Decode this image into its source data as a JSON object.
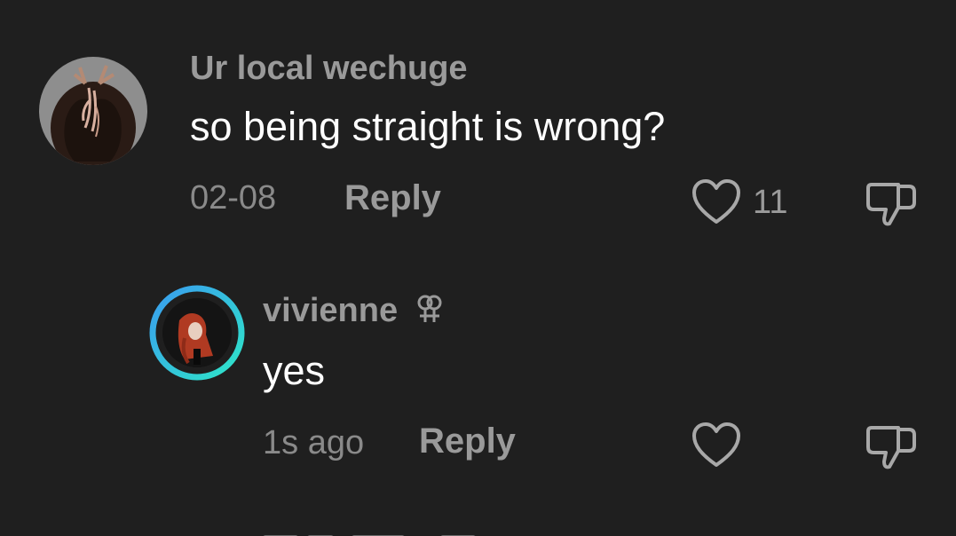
{
  "comments": [
    {
      "username": "Ur local wechuge",
      "text": "so being straight is wrong?",
      "time": "02-08",
      "reply_label": "Reply",
      "like_count": "11",
      "avatar_icon": "avatar-antlered-figure"
    }
  ],
  "replies": [
    {
      "username": "vivienne",
      "badge_icon": "lesbian-symbol-icon",
      "text": "yes",
      "time": "1s ago",
      "reply_label": "Reply",
      "like_count": "",
      "avatar_icon": "avatar-red-hair",
      "story_ring_colors": [
        "#3a9cf0",
        "#2ee6c8"
      ]
    }
  ],
  "colors": {
    "background": "#1f1f1f",
    "username": "#9a9a9a",
    "text": "#ffffff",
    "meta": "#8a8a8a"
  }
}
